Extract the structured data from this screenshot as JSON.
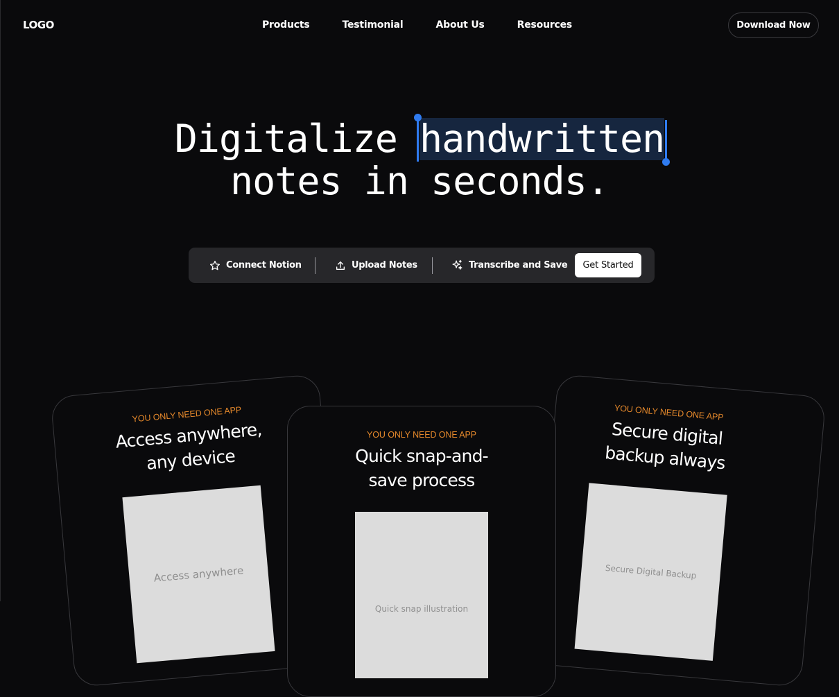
{
  "header": {
    "logo": "LOGO",
    "nav": [
      "Products",
      "Testimonial",
      "About Us",
      "Resources"
    ],
    "download_label": "Download Now"
  },
  "hero": {
    "line1_before": "Digitalize ",
    "highlight": "handwritten",
    "line2": "notes in seconds."
  },
  "actions": {
    "connect": "Connect Notion",
    "upload": "Upload Notes",
    "transcribe": "Transcribe and Save",
    "get_started": "Get Started"
  },
  "cards": [
    {
      "eyebrow": "YOU ONLY NEED ONE APP",
      "title_l1": "Access anywhere,",
      "title_l2": "any device",
      "illustration": "Access anywhere"
    },
    {
      "eyebrow": "YOU ONLY NEED ONE APP",
      "title_l1": "Quick snap-and-",
      "title_l2": "save process",
      "illustration": "Quick snap illustration"
    },
    {
      "eyebrow": "YOU ONLY NEED ONE APP",
      "title_l1": "Secure digital",
      "title_l2": "backup always",
      "illustration": "Secure Digital Backup"
    }
  ],
  "colors": {
    "background": "#0a0a0c",
    "accent_orange": "#e6892b",
    "selection_blue": "#2f7bf0"
  },
  "icons": {
    "connect": "star-icon",
    "upload": "upload-icon",
    "transcribe": "sparkles-icon"
  }
}
